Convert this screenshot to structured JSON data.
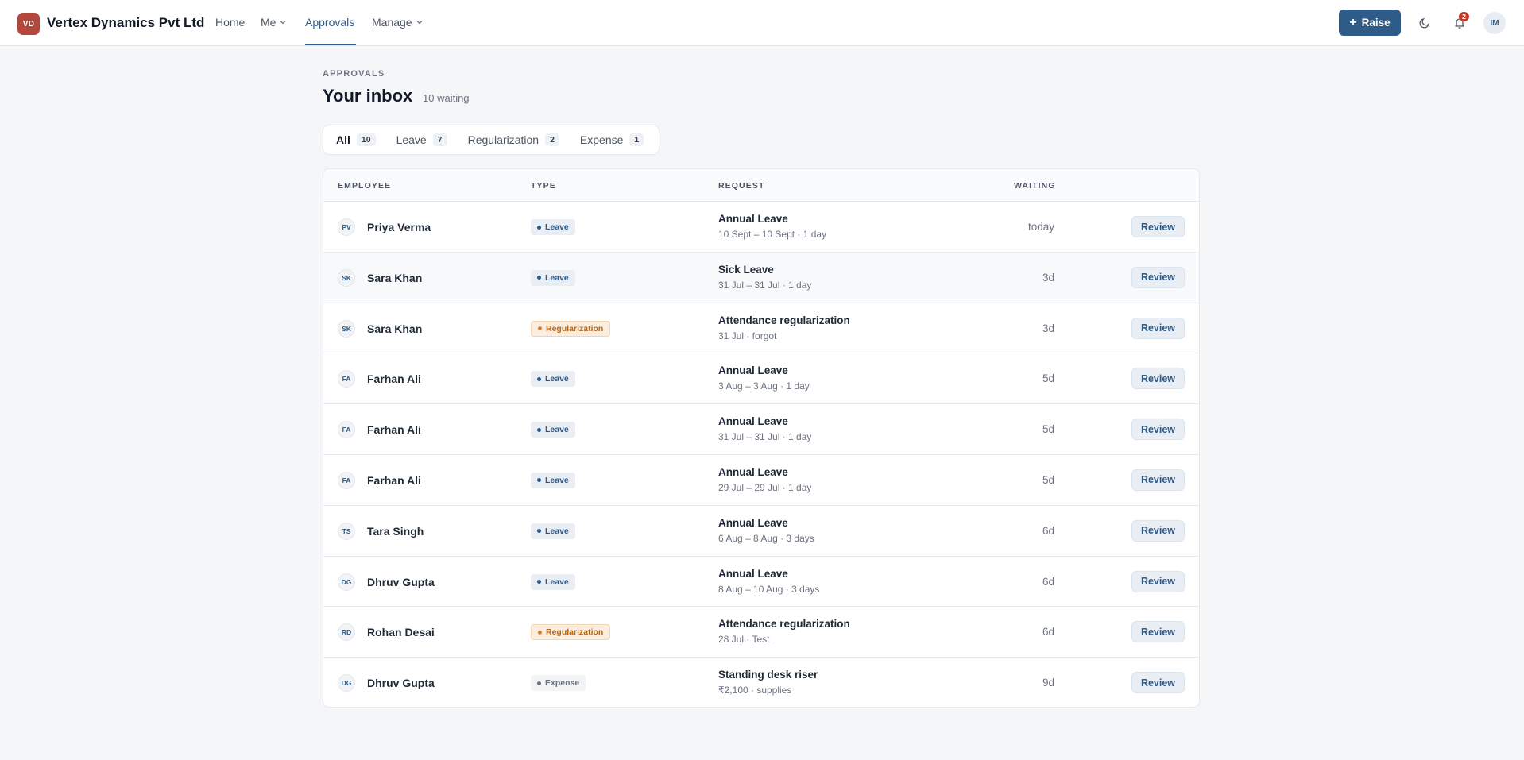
{
  "brand": {
    "initials": "VD",
    "name": "Vertex Dynamics Pvt Ltd",
    "accent": "#b4473c"
  },
  "nav": {
    "home": "Home",
    "me": "Me",
    "approvals": "Approvals",
    "manage": "Manage"
  },
  "actions": {
    "raise_label": "Raise",
    "notification_count": "2",
    "user_initials": "IM"
  },
  "header": {
    "eyebrow": "APPROVALS",
    "title": "Your inbox",
    "waiting": "10 waiting"
  },
  "tabs": [
    {
      "label": "All",
      "count": "10",
      "active": true
    },
    {
      "label": "Leave",
      "count": "7"
    },
    {
      "label": "Regularization",
      "count": "2"
    },
    {
      "label": "Expense",
      "count": "1"
    }
  ],
  "table": {
    "columns": {
      "employee": "EMPLOYEE",
      "type": "TYPE",
      "request": "REQUEST",
      "waiting": "WAITING"
    },
    "review_label": "Review",
    "rows": [
      {
        "initials": "PV",
        "name": "Priya Verma",
        "type": "Leave",
        "type_class": "leave",
        "title": "Annual Leave",
        "detail": "10 Sept – 10 Sept · 1 day",
        "waiting": "today"
      },
      {
        "initials": "SK",
        "name": "Sara Khan",
        "type": "Leave",
        "type_class": "leave",
        "title": "Sick Leave",
        "detail": "31 Jul – 31 Jul · 1 day",
        "waiting": "3d"
      },
      {
        "initials": "SK",
        "name": "Sara Khan",
        "type": "Regularization",
        "type_class": "regularization",
        "title": "Attendance regularization",
        "detail": "31 Jul · forgot",
        "waiting": "3d"
      },
      {
        "initials": "FA",
        "name": "Farhan Ali",
        "type": "Leave",
        "type_class": "leave",
        "title": "Annual Leave",
        "detail": "3 Aug – 3 Aug · 1 day",
        "waiting": "5d"
      },
      {
        "initials": "FA",
        "name": "Farhan Ali",
        "type": "Leave",
        "type_class": "leave",
        "title": "Annual Leave",
        "detail": "31 Jul – 31 Jul · 1 day",
        "waiting": "5d"
      },
      {
        "initials": "FA",
        "name": "Farhan Ali",
        "type": "Leave",
        "type_class": "leave",
        "title": "Annual Leave",
        "detail": "29 Jul – 29 Jul · 1 day",
        "waiting": "5d"
      },
      {
        "initials": "TS",
        "name": "Tara Singh",
        "type": "Leave",
        "type_class": "leave",
        "title": "Annual Leave",
        "detail": "6 Aug – 8 Aug · 3 days",
        "waiting": "6d"
      },
      {
        "initials": "DG",
        "name": "Dhruv Gupta",
        "type": "Leave",
        "type_class": "leave",
        "title": "Annual Leave",
        "detail": "8 Aug – 10 Aug · 3 days",
        "waiting": "6d"
      },
      {
        "initials": "RD",
        "name": "Rohan Desai",
        "type": "Regularization",
        "type_class": "regularization",
        "title": "Attendance regularization",
        "detail": "28 Jul · Test",
        "waiting": "6d"
      },
      {
        "initials": "DG",
        "name": "Dhruv Gupta",
        "type": "Expense",
        "type_class": "expense",
        "title": "Standing desk riser",
        "detail": "₹2,100 · supplies",
        "waiting": "9d"
      }
    ]
  }
}
